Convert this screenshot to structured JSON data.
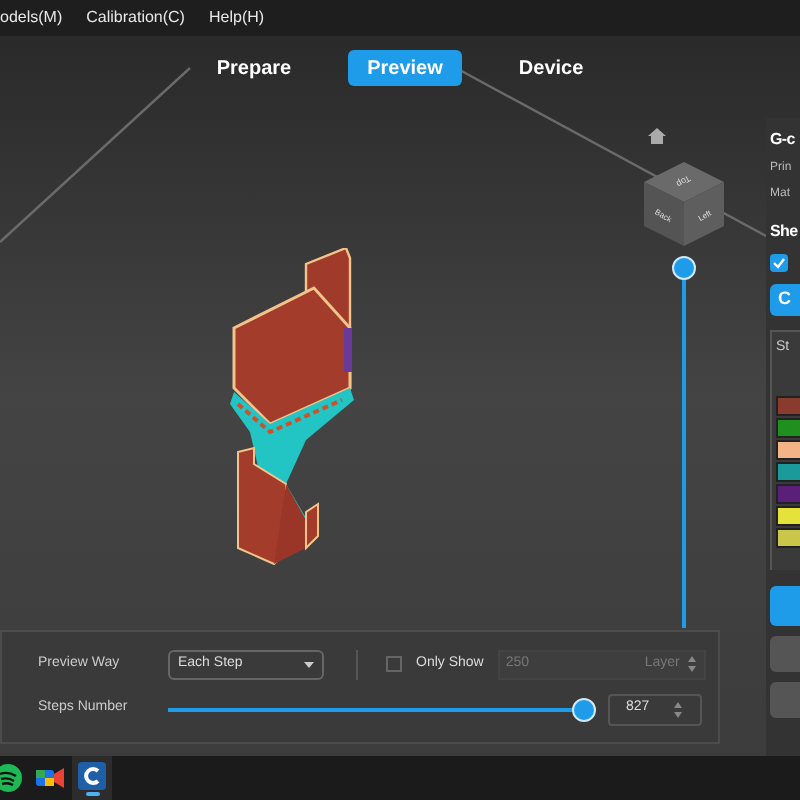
{
  "menu": [
    "odels(M)",
    "Calibration(C)",
    "Help(H)"
  ],
  "tabs": [
    {
      "label": "Prepare",
      "selected": false
    },
    {
      "label": "Preview",
      "selected": true
    },
    {
      "label": "Device",
      "selected": false
    }
  ],
  "view_cube": {
    "faces": [
      "Top",
      "Back",
      "Left"
    ]
  },
  "layer_slider": {
    "level": 1
  },
  "side_panel": {
    "title": "G-c",
    "lines": [
      "Prin",
      "Mat"
    ],
    "section": "She",
    "show_checked": true,
    "button": "C",
    "table_header": "St",
    "swatches": [
      {
        "color": "#8b3a2e"
      },
      {
        "color": "#1f8f1f"
      },
      {
        "color": "#f2b487"
      },
      {
        "color": "#1a9a9a"
      },
      {
        "color": "#5a1f78"
      },
      {
        "color": "#e6e23c"
      },
      {
        "color": "#c9c64a"
      }
    ]
  },
  "bottom_panel": {
    "preview_way_label": "Preview Way",
    "preview_way_value": "Each Step",
    "only_show_checked": false,
    "only_show_label": "Only Show",
    "layer_value": "250",
    "layer_unit": "Layer",
    "steps_label": "Steps Number",
    "steps": {
      "level": 1
    },
    "steps_value": "827"
  },
  "taskbar": [
    {
      "kind": "round",
      "active": false
    },
    {
      "kind": "camera",
      "active": false
    },
    {
      "kind": "slicer",
      "active": true
    }
  ]
}
